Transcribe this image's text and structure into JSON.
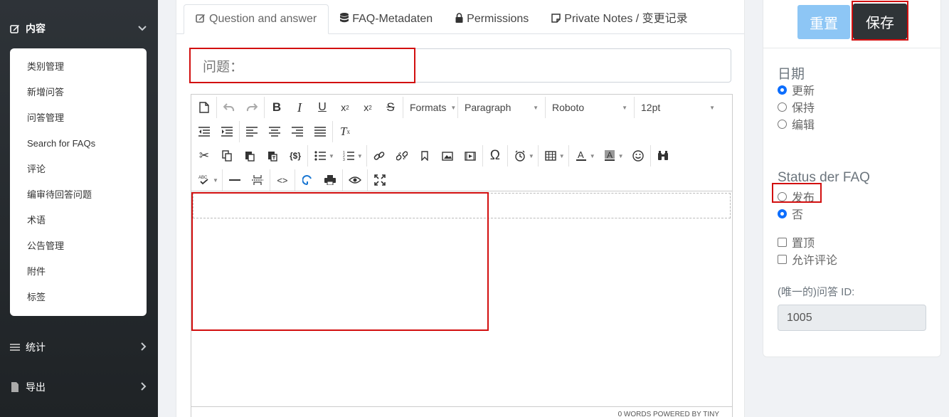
{
  "sidebar": {
    "content_section": {
      "label": "内容"
    },
    "items": [
      {
        "label": "类别管理"
      },
      {
        "label": "新增问答"
      },
      {
        "label": "问答管理"
      },
      {
        "label": "Search for FAQs"
      },
      {
        "label": "评论"
      },
      {
        "label": "编审待回答问题"
      },
      {
        "label": "术语"
      },
      {
        "label": "公告管理"
      },
      {
        "label": "附件"
      },
      {
        "label": "标签"
      }
    ],
    "stats_section": {
      "label": "统计"
    },
    "export_section": {
      "label": "导出"
    }
  },
  "tabs": [
    {
      "label": "Question and answer",
      "icon": "edit-icon",
      "active": true
    },
    {
      "label": "FAQ-Metadaten",
      "icon": "database-icon"
    },
    {
      "label": "Permissions",
      "icon": "lock-icon"
    },
    {
      "label": "Private Notes / 变更记录",
      "icon": "note-icon"
    }
  ],
  "question": {
    "placeholder": "问题："
  },
  "editor": {
    "formats_label": "Formats",
    "block_label": "Paragraph",
    "font_label": "Roboto",
    "size_label": "12pt",
    "status_text": "0 WORDS POWERED BY TINY"
  },
  "actions": {
    "reset_label": "重置",
    "save_label": "保存"
  },
  "date_section": {
    "heading": "日期",
    "options": [
      {
        "label": "更新",
        "checked": true
      },
      {
        "label": "保持",
        "checked": false
      },
      {
        "label": "编辑",
        "checked": false
      }
    ]
  },
  "status_section": {
    "heading": "Status der FAQ",
    "options": [
      {
        "label": "发布",
        "checked": false
      },
      {
        "label": "否",
        "checked": true
      }
    ]
  },
  "flags": [
    {
      "label": "置顶",
      "checked": false
    },
    {
      "label": "允许评论",
      "checked": false
    }
  ],
  "id_field": {
    "label": "(唯一的)问答 ID:",
    "value": "1005"
  },
  "colors": {
    "sidebar_bg": "#2e3338",
    "accent": "#0d6efd",
    "reset_btn": "#8dc6f5",
    "save_btn": "#2f3437",
    "highlight": "#d20f0f"
  }
}
